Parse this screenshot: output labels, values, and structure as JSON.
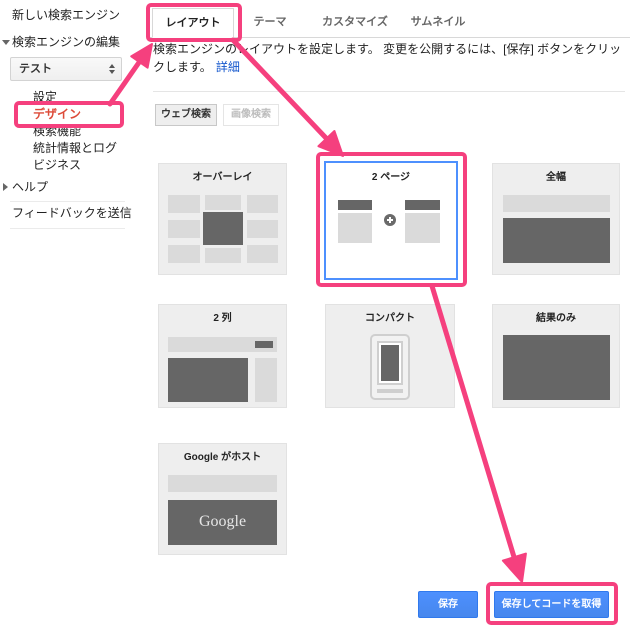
{
  "sidebar": {
    "new_engine_link": "新しい検索エンジン",
    "edit_section": {
      "label": "検索エンジンの編集",
      "expanded": true
    },
    "engine_select": {
      "selected": "テスト"
    },
    "items": [
      {
        "label": "設定",
        "active": false
      },
      {
        "label": "デザイン",
        "active": true
      },
      {
        "label": "検索機能",
        "active": false
      },
      {
        "label": "統計情報とログ",
        "active": false
      },
      {
        "label": "ビジネス",
        "active": false
      }
    ],
    "help_section": {
      "label": "ヘルプ",
      "expanded": false
    },
    "feedback_link": "フィードバックを送信"
  },
  "tabs": [
    {
      "label": "レイアウト",
      "selected": true
    },
    {
      "label": "テーマ",
      "selected": false
    },
    {
      "label": "カスタマイズ",
      "selected": false
    },
    {
      "label": "サムネイル",
      "selected": false
    }
  ],
  "description": {
    "text": "検索エンジンのレイアウトを設定します。 変更を公開するには、[保存] ボタンをクリックします。",
    "link_label": "詳細"
  },
  "search_type_tabs": [
    {
      "label": "ウェブ検索",
      "selected": true,
      "disabled": false
    },
    {
      "label": "画像検索",
      "selected": false,
      "disabled": true
    }
  ],
  "layouts": [
    {
      "label": "オーバーレイ",
      "selected": false
    },
    {
      "label": "2 ページ",
      "selected": true
    },
    {
      "label": "全幅",
      "selected": false
    },
    {
      "label": "2 列",
      "selected": false
    },
    {
      "label": "コンパクト",
      "selected": false
    },
    {
      "label": "結果のみ",
      "selected": false
    },
    {
      "label": "Google がホスト",
      "selected": false,
      "logo_text": "Google"
    }
  ],
  "actions": {
    "save_label": "保存",
    "save_and_get_code_label": "保存してコードを取得"
  },
  "icons": {
    "edit_section_toggle": "triangle-down-icon",
    "help_section_toggle": "triangle-right-icon",
    "engine_select_arrows": "up-down-arrows-icon",
    "two_page_join": "plus-circle-icon",
    "compact_preview": "smartphone-icon"
  },
  "colors": {
    "primary_button": "#4d90fe",
    "selected_layout_border": "#4d90fe",
    "active_nav_text": "#dd4b39",
    "link": "#1155cc",
    "annotation": "#f5407e",
    "thumbnail_light": "#dadada",
    "thumbnail_dark": "#666666"
  }
}
